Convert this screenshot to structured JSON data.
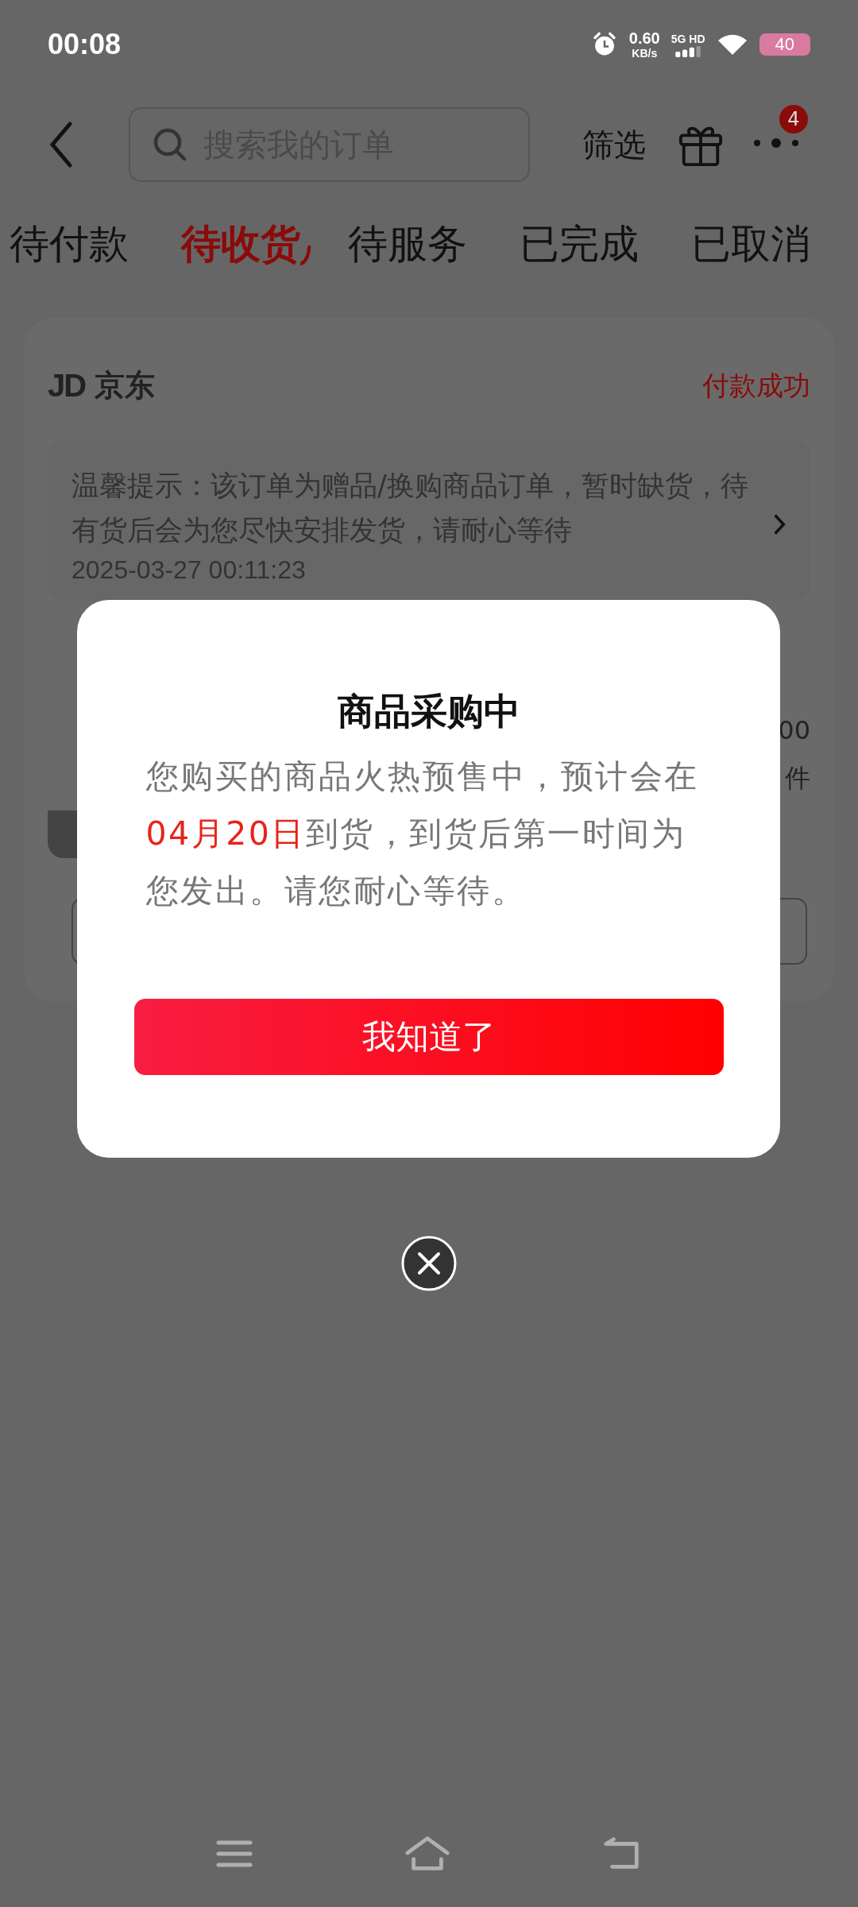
{
  "status_bar": {
    "time": "00:08",
    "speed": "0.60",
    "speed_unit": "KB/s",
    "network": "5G HD",
    "battery": "40"
  },
  "header": {
    "search": {
      "placeholder": "搜索我的订单"
    },
    "filter": "筛选",
    "more_badge": "4"
  },
  "tabs": [
    {
      "label": "待付款",
      "selected": false
    },
    {
      "label": "待收货",
      "selected": true
    },
    {
      "label": "待服务",
      "selected": false
    },
    {
      "label": "已完成",
      "selected": false
    },
    {
      "label": "已取消",
      "selected": false
    }
  ],
  "order": {
    "shop_logo": "JD",
    "shop": "京东",
    "status": "付款成功",
    "tip": "温馨提示：该订单为赠品/换购商品订单，暂时缺货，待有货后会为您尽快安排发货，请耐心等待",
    "tip_time": "2025-03-27 00:11:23",
    "price_fragment": "00",
    "count_fragment": "件"
  },
  "dialog": {
    "title": "商品采购中",
    "message": "您购买的商品火热预售中，预计会在**04月20日**到货，到货后第一时间为您发出。请您耐心等待。",
    "button": "我知道了"
  }
}
